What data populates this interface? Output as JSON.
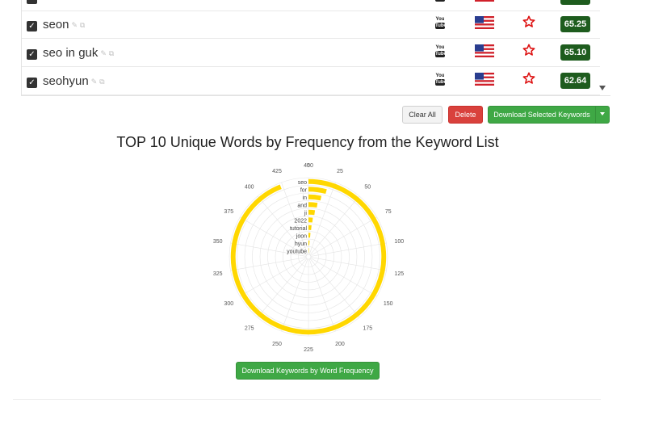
{
  "keywords": [
    {
      "text": "",
      "score": "",
      "partial": true
    },
    {
      "text": "seon",
      "score": "65.25",
      "partial": false
    },
    {
      "text": "seo in guk",
      "score": "65.10",
      "partial": false
    },
    {
      "text": "seohyun",
      "score": "62.64",
      "partial": false
    }
  ],
  "keyword_icons": {
    "youtube_top": "You",
    "youtube_bottom": "Tube",
    "tools": "✎ ⧉",
    "checkbox": "✓"
  },
  "toolbar": {
    "clear_label": "Clear All",
    "delete_label": "Delete",
    "download_label": "Download Selected Keywords"
  },
  "chart_title": "TOP 10 Unique Words by Frequency from the Keyword List",
  "freq_button_label": "Download Keywords by Word Frequency",
  "colors": {
    "bar": "#ffd700",
    "score_bg": "#1e5c1e",
    "delete": "#d9413c",
    "download": "#3fa845",
    "star": "#dd1111"
  },
  "chart_data": {
    "type": "bar",
    "layout": "radial",
    "title": "TOP 10 Unique Words by Frequency from the Keyword List",
    "categories": [
      "seo",
      "for",
      "in",
      "and",
      "ji",
      "2022",
      "tutorial",
      "joon",
      "hyun",
      "youtube"
    ],
    "values": [
      423,
      19,
      15,
      12,
      10,
      8,
      7,
      6,
      5,
      4
    ],
    "axis_ticks": [
      0,
      25,
      50,
      75,
      100,
      125,
      150,
      175,
      200,
      225,
      250,
      275,
      300,
      325,
      350,
      375,
      400,
      425,
      450
    ],
    "range": [
      0,
      450
    ],
    "grid": true
  }
}
